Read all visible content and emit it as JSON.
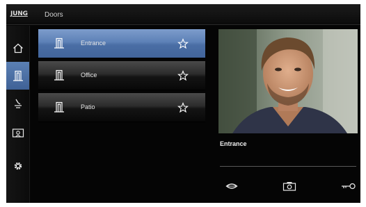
{
  "header": {
    "brand": "JUNG",
    "title": "Doors"
  },
  "sidebar": {
    "items": [
      {
        "name": "home",
        "icon": "home-icon",
        "active": false
      },
      {
        "name": "doors",
        "icon": "door-icon",
        "active": true
      },
      {
        "name": "lights",
        "icon": "light-switch-icon",
        "active": false
      },
      {
        "name": "camera",
        "icon": "camera-icon",
        "active": false
      },
      {
        "name": "settings",
        "icon": "gear-icon",
        "active": false
      }
    ]
  },
  "doors": [
    {
      "label": "Entrance",
      "selected": true
    },
    {
      "label": "Office",
      "selected": false
    },
    {
      "label": "Patio",
      "selected": false
    }
  ],
  "camera": {
    "label": "Entrance",
    "actions": [
      {
        "name": "talk",
        "icon": "speak-icon"
      },
      {
        "name": "snapshot",
        "icon": "photo-camera-icon"
      },
      {
        "name": "open-door",
        "icon": "key-icon"
      }
    ]
  },
  "colors": {
    "accent": "#5b80b4",
    "background": "#050505",
    "text": "#e6e6e6"
  }
}
